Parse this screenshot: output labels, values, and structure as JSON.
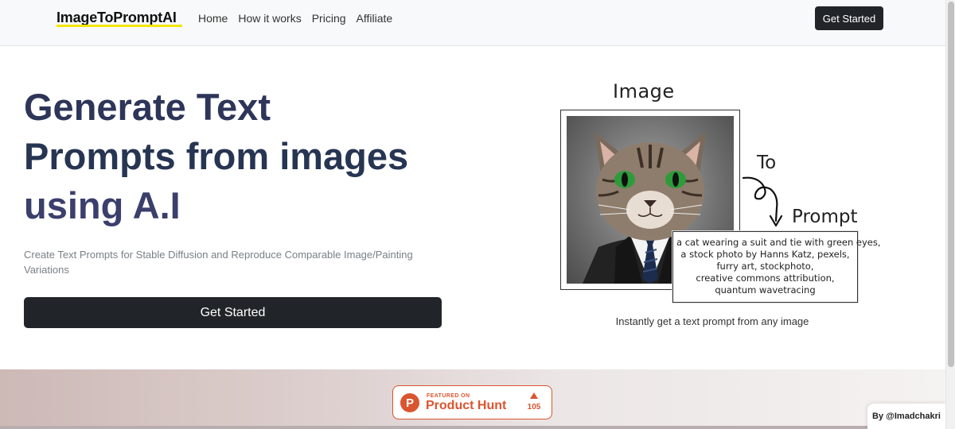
{
  "navbar": {
    "brand": "ImageToPromptAI",
    "links": [
      "Home",
      "How it works",
      "Pricing",
      "Affiliate"
    ],
    "cta_label": "Get Started"
  },
  "hero": {
    "title_lines": [
      "Generate Text",
      "Prompts from images",
      "using A.I"
    ],
    "subtitle": "Create Text Prompts for Stable Diffusion and Reproduce Comparable Image/Painting Variations",
    "cta_label": "Get Started"
  },
  "illustration": {
    "image_label": "Image",
    "to_label": "To",
    "prompt_label": "Prompt",
    "prompt_lines": [
      "a cat wearing a suit and tie with green eyes,",
      "a stock photo by Hanns Katz, pexels,",
      "furry art, stockphoto,",
      "creative commons attribution,",
      "quantum wavetracing"
    ],
    "caption": "Instantly get a text prompt from any image"
  },
  "producthunt": {
    "featured_on": "FEATURED ON",
    "name": "Product Hunt",
    "logo_letter": "P",
    "upvotes": "105",
    "brand_color": "#da552f"
  },
  "credit": {
    "label": "By @Imadchakri"
  },
  "colors": {
    "navbar_bg": "#f8f9fa",
    "button_dark": "#212529",
    "brand_underline": "#f2e600",
    "hero_title": "#2c3557"
  }
}
